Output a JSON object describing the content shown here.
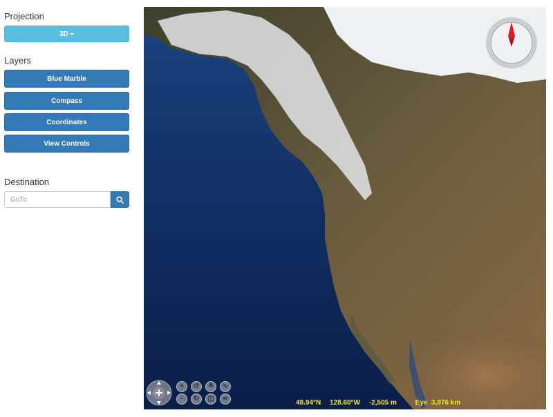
{
  "sidebar": {
    "projection": {
      "title": "Projection",
      "button_label": "3D"
    },
    "layers": {
      "title": "Layers",
      "items": [
        "Blue Marble",
        "Compass",
        "Coordinates",
        "View Controls"
      ]
    },
    "destination": {
      "title": "Destination",
      "placeholder": "GoTo"
    }
  },
  "globe": {
    "status": {
      "latitude": "48.94°N",
      "longitude": "128.60°W",
      "elevation": "-2,505 m",
      "eye": "Eye  3,976 km"
    }
  },
  "icons": {
    "search": "magnifier",
    "compass": "compass-rose",
    "pan": "pan-arrows",
    "zoom_in": "plus",
    "zoom_out": "minus",
    "rotate": "rotate",
    "tilt": "tilt",
    "flatten": "flatten"
  },
  "colors": {
    "projection_button": "#5bc0de",
    "layer_button": "#337ab7",
    "status_text": "#f5e623"
  }
}
